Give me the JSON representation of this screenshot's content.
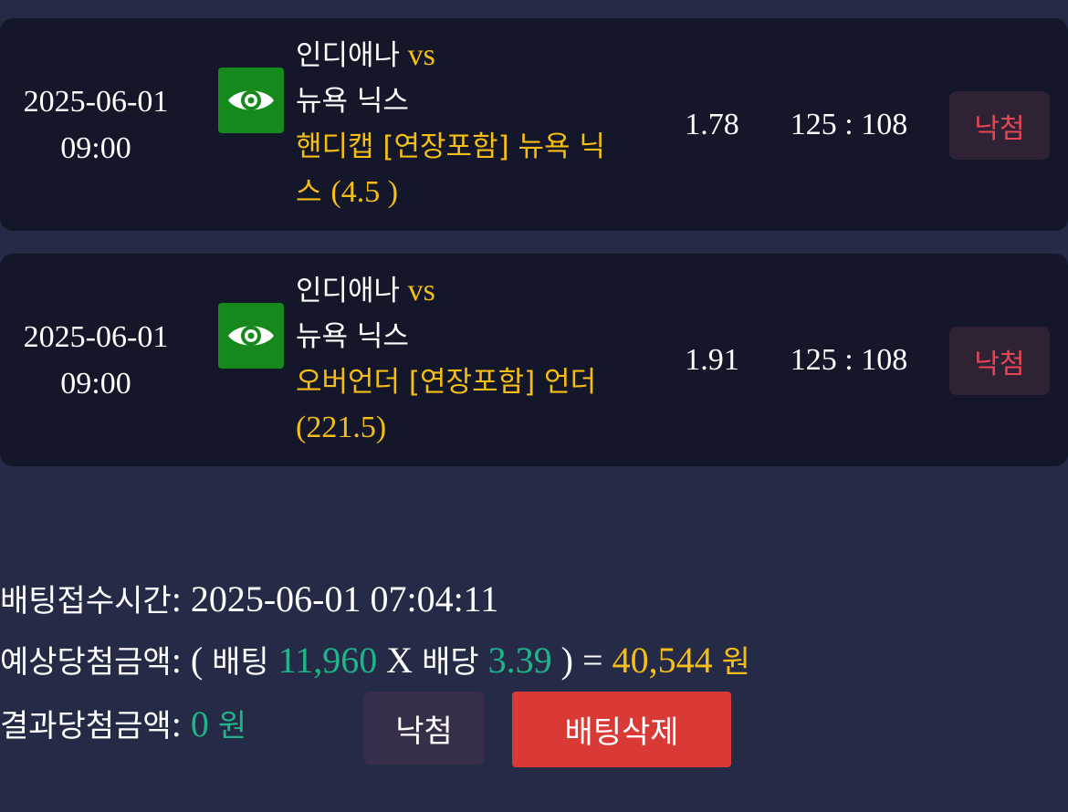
{
  "bets": [
    {
      "date": "2025-06-01",
      "time": "09:00",
      "home_team": "인디애나",
      "vs": "vs",
      "away_team": "뉴욕 닉스",
      "bet_type": "핸디캡 [연장포함] 뉴욕 닉스",
      "bet_line": "(4.5 )",
      "odds": "1.78",
      "score": "125 : 108",
      "status": "낙첨"
    },
    {
      "date": "2025-06-01",
      "time": "09:00",
      "home_team": "인디애나",
      "vs": "vs",
      "away_team": "뉴욕 닉스",
      "bet_type": "오버언더 [연장포함] 언더",
      "bet_line": "(221.5)",
      "odds": "1.91",
      "score": "125 : 108",
      "status": "낙첨"
    }
  ],
  "summary": {
    "receipt_label": "배팅접수시간",
    "receipt_time": "2025-06-01 07:04:11",
    "expected_label": "예상당첨금액",
    "open_paren": "(",
    "bet_word": "배팅",
    "bet_amount": "11,960",
    "times": "X",
    "odds_word": "배당",
    "total_odds": "3.39",
    "close_eq": ") =",
    "expected_amount": "40,544",
    "won": "원",
    "result_label": "결과당첨금액",
    "result_amount": "0",
    "result_won": "원"
  },
  "buttons": {
    "result_status": "낙첨",
    "delete_bet": "배팅삭제"
  },
  "icons": {
    "view": "eye-icon"
  },
  "colors": {
    "background": "#252b47",
    "card": "#131729",
    "highlight_yellow": "#f6bd17",
    "amount_green": "#1fb588",
    "loss_red": "#e64653",
    "eye_green": "#15891b",
    "delete_red": "#d93a36"
  }
}
